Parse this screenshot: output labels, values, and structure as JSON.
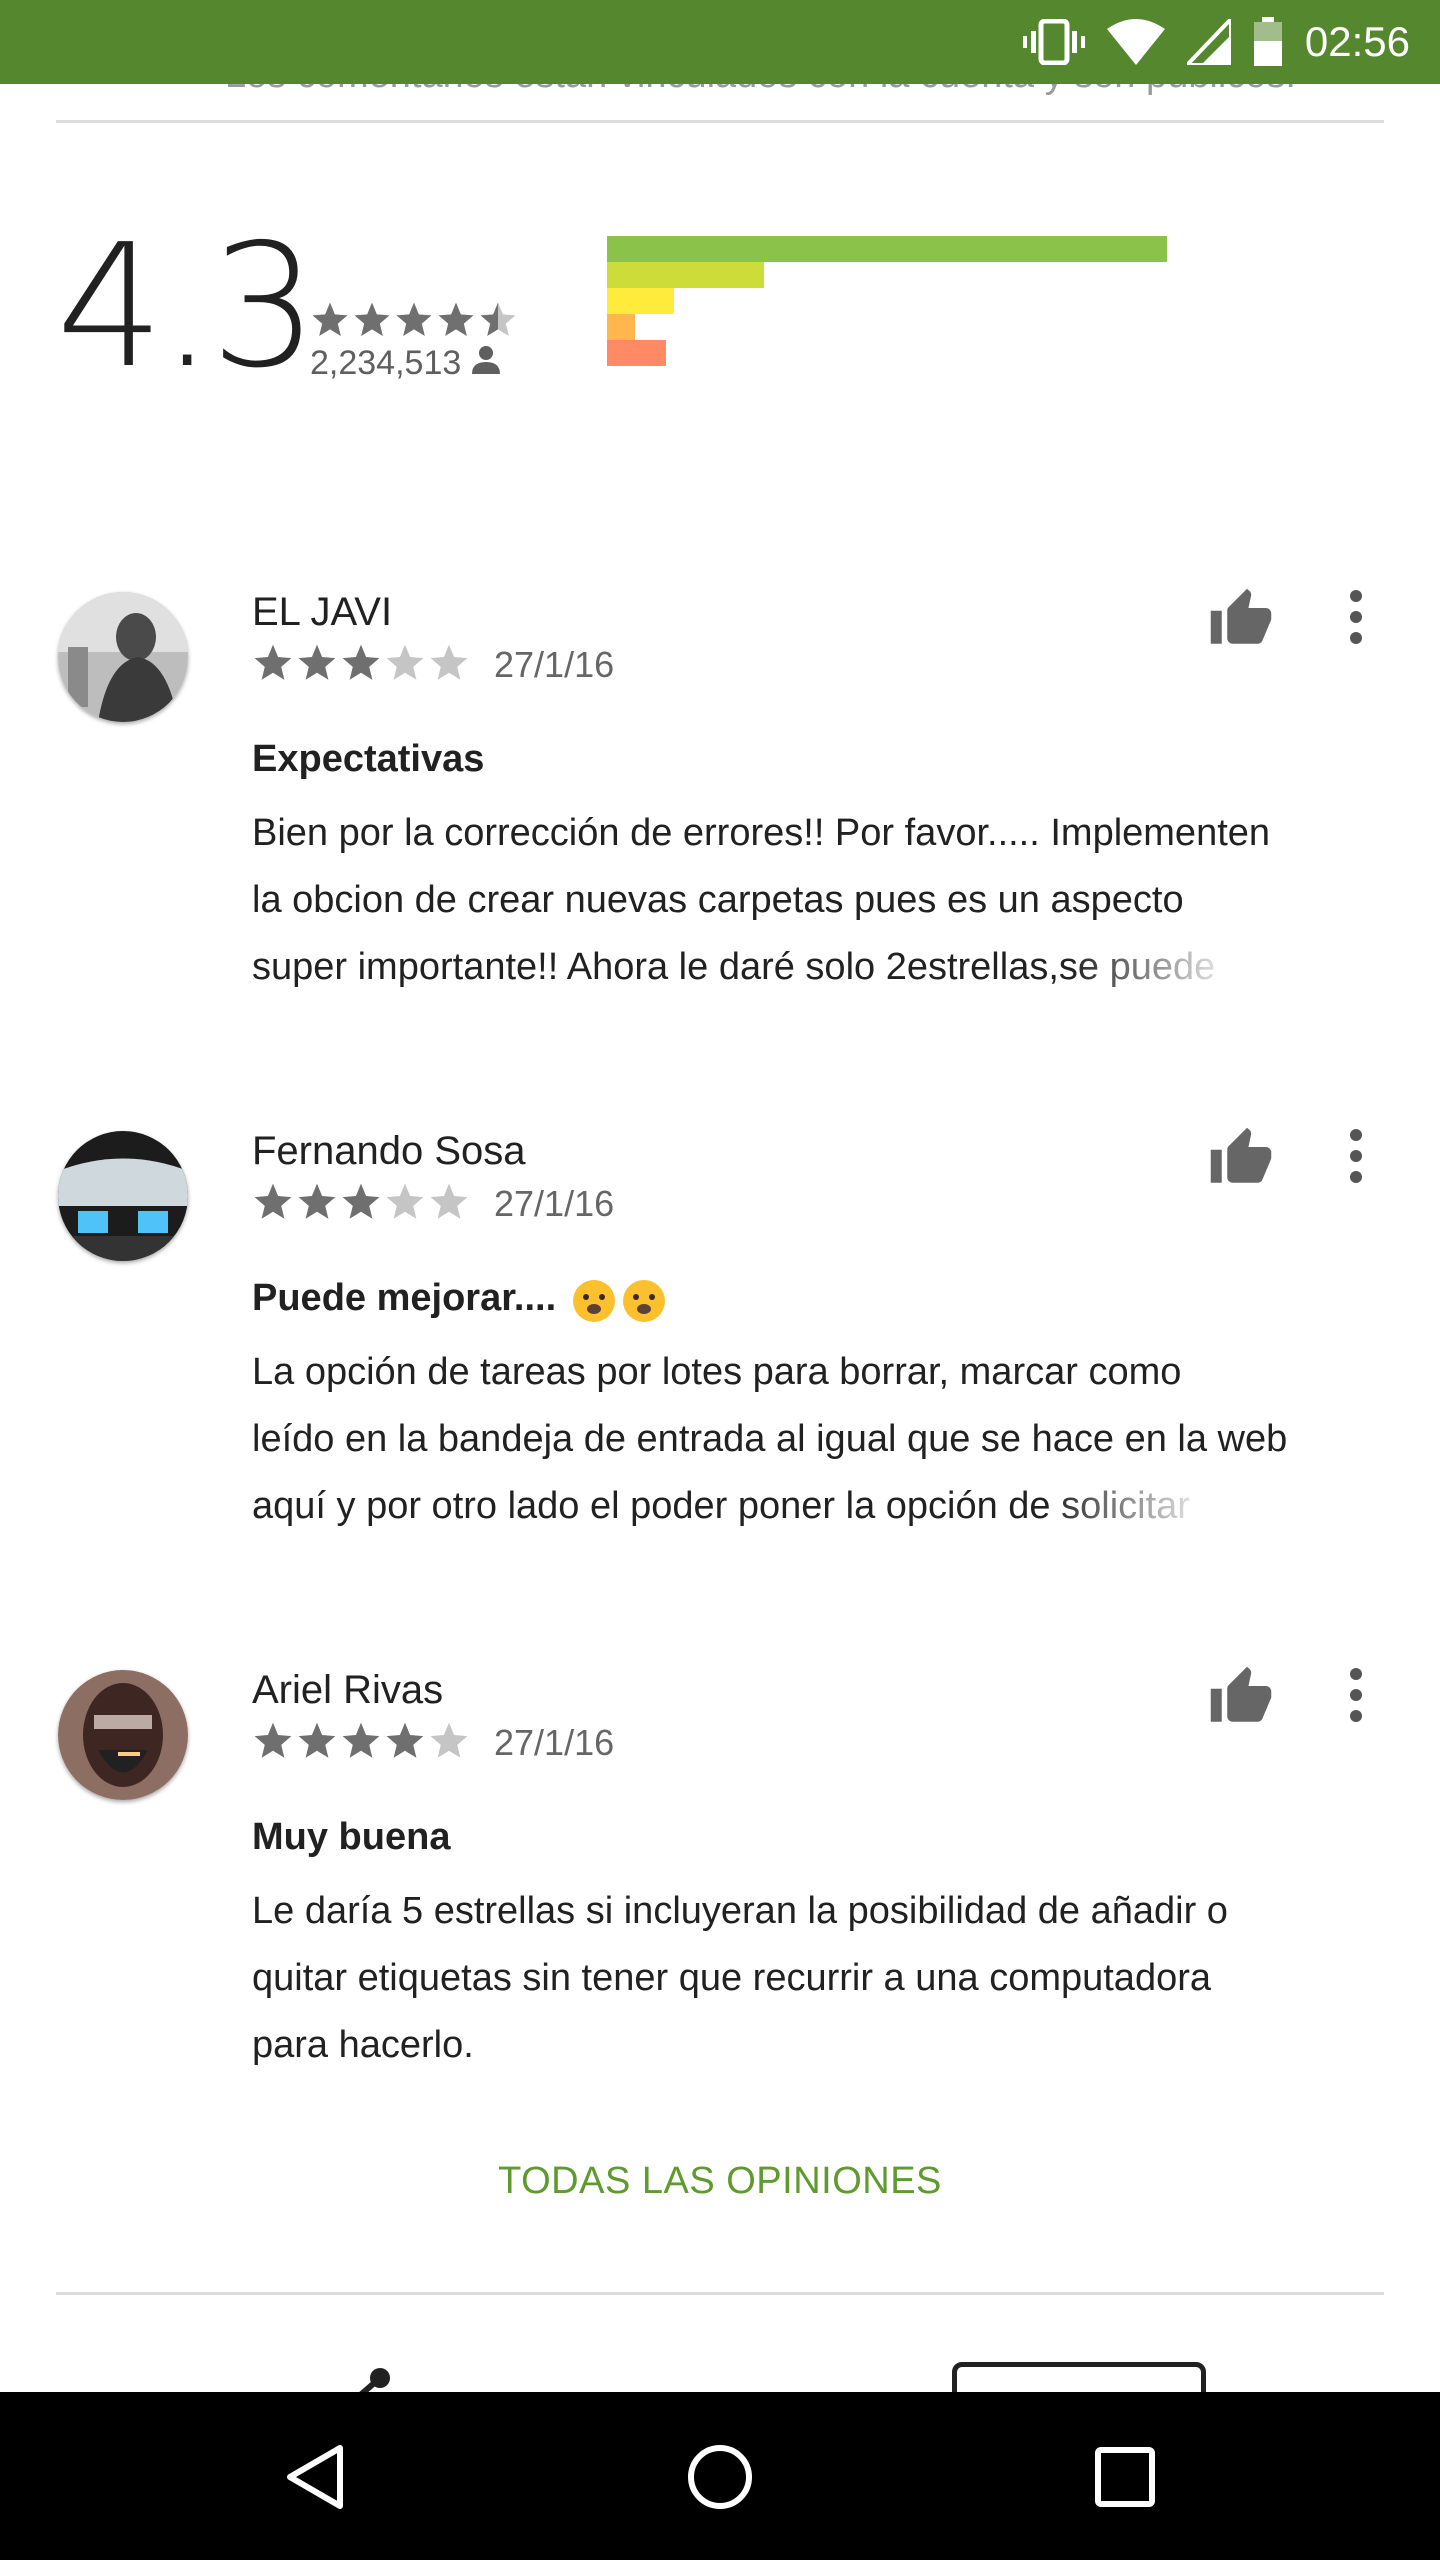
{
  "status_bar": {
    "time": "02:56"
  },
  "header": {
    "clipped_text": "Los comentarios están vinculados con la cuenta y son públicos."
  },
  "summary": {
    "average": "4.3",
    "total_reviews": "2,234,513",
    "stars_filled": 4.5,
    "distribution_colors": [
      "#8bc34a",
      "#cddc39",
      "#ffeb3b",
      "#ffb74d",
      "#ff8a65"
    ],
    "distribution": [
      1.0,
      0.28,
      0.12,
      0.05,
      0.105
    ]
  },
  "reviews": [
    {
      "name": "EL JAVI",
      "rating": 3,
      "date": "27/1/16",
      "title": "Expectativas",
      "body_lines": [
        "Bien por la corrección de errores!! Por favor..... Implementen",
        "la obcion de crear nuevas carpetas pues es un aspecto",
        "super importante!! Ahora le daré solo 2estrellas,se puede"
      ]
    },
    {
      "name": "Fernando Sosa",
      "rating": 3,
      "date": "27/1/16",
      "title": "Puede mejorar....",
      "body_lines": [
        "La opción de tareas por lotes para borrar, marcar como",
        "leído en la bandeja de entrada al igual que se hace en la web",
        "aquí y por otro lado el poder poner la opción de solicitar"
      ]
    },
    {
      "name": "Ariel Rivas",
      "rating": 4,
      "date": "27/1/16",
      "title": "Muy buena",
      "body_lines": [
        "Le daría 5 estrellas si incluyeran la posibilidad de añadir o",
        "quitar etiquetas sin tener que recurrir a una computadora",
        "para hacerlo."
      ]
    }
  ],
  "all_reviews_label": "TODAS LAS OPINIONES",
  "icons": {
    "vibrate": "vibrate-icon",
    "wifi": "wifi-icon",
    "signal": "signal-icon",
    "battery": "battery-icon",
    "thumb": "thumb-up-icon",
    "more": "more-vert-icon",
    "back": "back-icon",
    "home": "home-icon",
    "recents": "recents-icon"
  }
}
